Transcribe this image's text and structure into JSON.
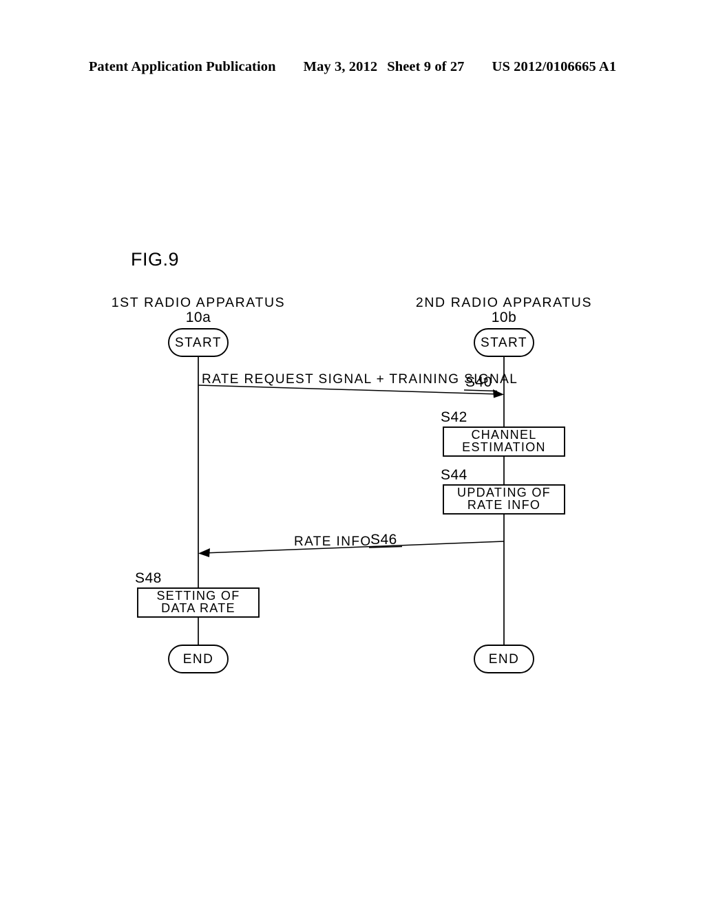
{
  "page_header": {
    "publication": "Patent Application Publication",
    "date": "May 3, 2012",
    "sheet": "Sheet 9 of 27",
    "number": "US 2012/0106665 A1"
  },
  "figure": {
    "label": "FIG.9"
  },
  "lanes": [
    {
      "title": "1ST RADIO APPARATUS",
      "reference": "10a",
      "start": "START",
      "end": "END"
    },
    {
      "title": "2ND RADIO APPARATUS",
      "reference": "10b",
      "start": "START",
      "end": "END"
    }
  ],
  "messages": [
    {
      "step": "S40",
      "label": "RATE REQUEST SIGNAL + TRAINING SIGNAL",
      "direction": "right"
    },
    {
      "step": "S46",
      "label": "RATE INFO",
      "direction": "left"
    }
  ],
  "process_boxes": [
    {
      "step": "S42",
      "line1": "CHANNEL",
      "line2": "ESTIMATION",
      "lane": "2nd"
    },
    {
      "step": "S44",
      "line1": "UPDATING OF",
      "line2": "RATE INFO",
      "lane": "2nd"
    },
    {
      "step": "S48",
      "line1": "SETTING OF",
      "line2": "DATA RATE",
      "lane": "1st"
    }
  ],
  "colors": {
    "ink": "#000000",
    "paper": "#ffffff"
  }
}
